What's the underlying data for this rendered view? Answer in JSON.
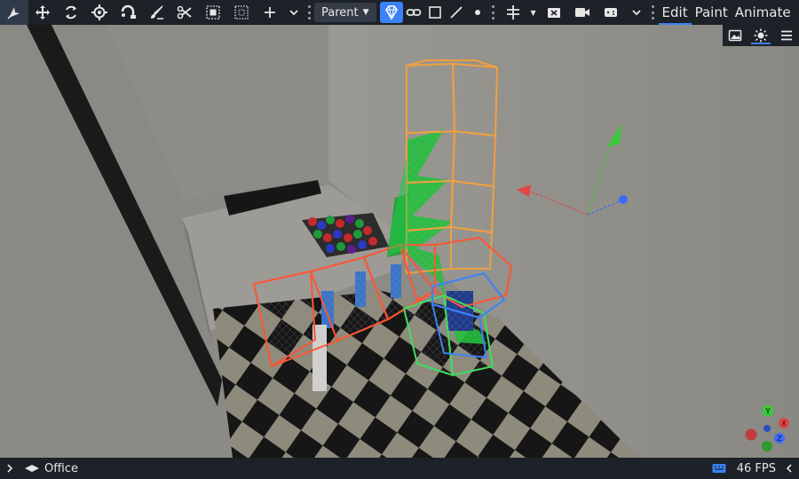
{
  "toolbar": {
    "tools": [
      {
        "name": "select-tool",
        "icon": "select-arrow-icon"
      },
      {
        "name": "move-tool",
        "icon": "move-icon"
      },
      {
        "name": "rotate-tool",
        "icon": "rotate-icon"
      },
      {
        "name": "scale-tool",
        "icon": "scale-icon"
      },
      {
        "name": "pivot-tool",
        "icon": "pivot-icon"
      },
      {
        "name": "paint-tool",
        "icon": "brush-icon"
      },
      {
        "name": "cut-tool",
        "icon": "scissors-icon"
      },
      {
        "name": "group-tool",
        "icon": "group-icon"
      },
      {
        "name": "bounds-tool",
        "icon": "bounds-icon"
      },
      {
        "name": "add-tool",
        "icon": "plus-icon"
      }
    ],
    "parent_label": "Parent",
    "modes": [
      "Edit",
      "Paint",
      "Animate"
    ],
    "active_mode": "Edit"
  },
  "status": {
    "scene_name": "Office",
    "fps": "46 FPS"
  },
  "gizmo": {
    "axes": [
      "Y",
      "X",
      "Z"
    ],
    "colors": {
      "x": "#e64545",
      "y": "#3cc83c",
      "z": "#3a6bff"
    }
  },
  "colors": {
    "accent": "#3b82f6",
    "toolbar_bg": "#1d2128",
    "selection_orange": "#f0a040",
    "selection_red": "#ff5533",
    "selection_green": "#40dd60",
    "selection_blue": "#3b82f6"
  }
}
